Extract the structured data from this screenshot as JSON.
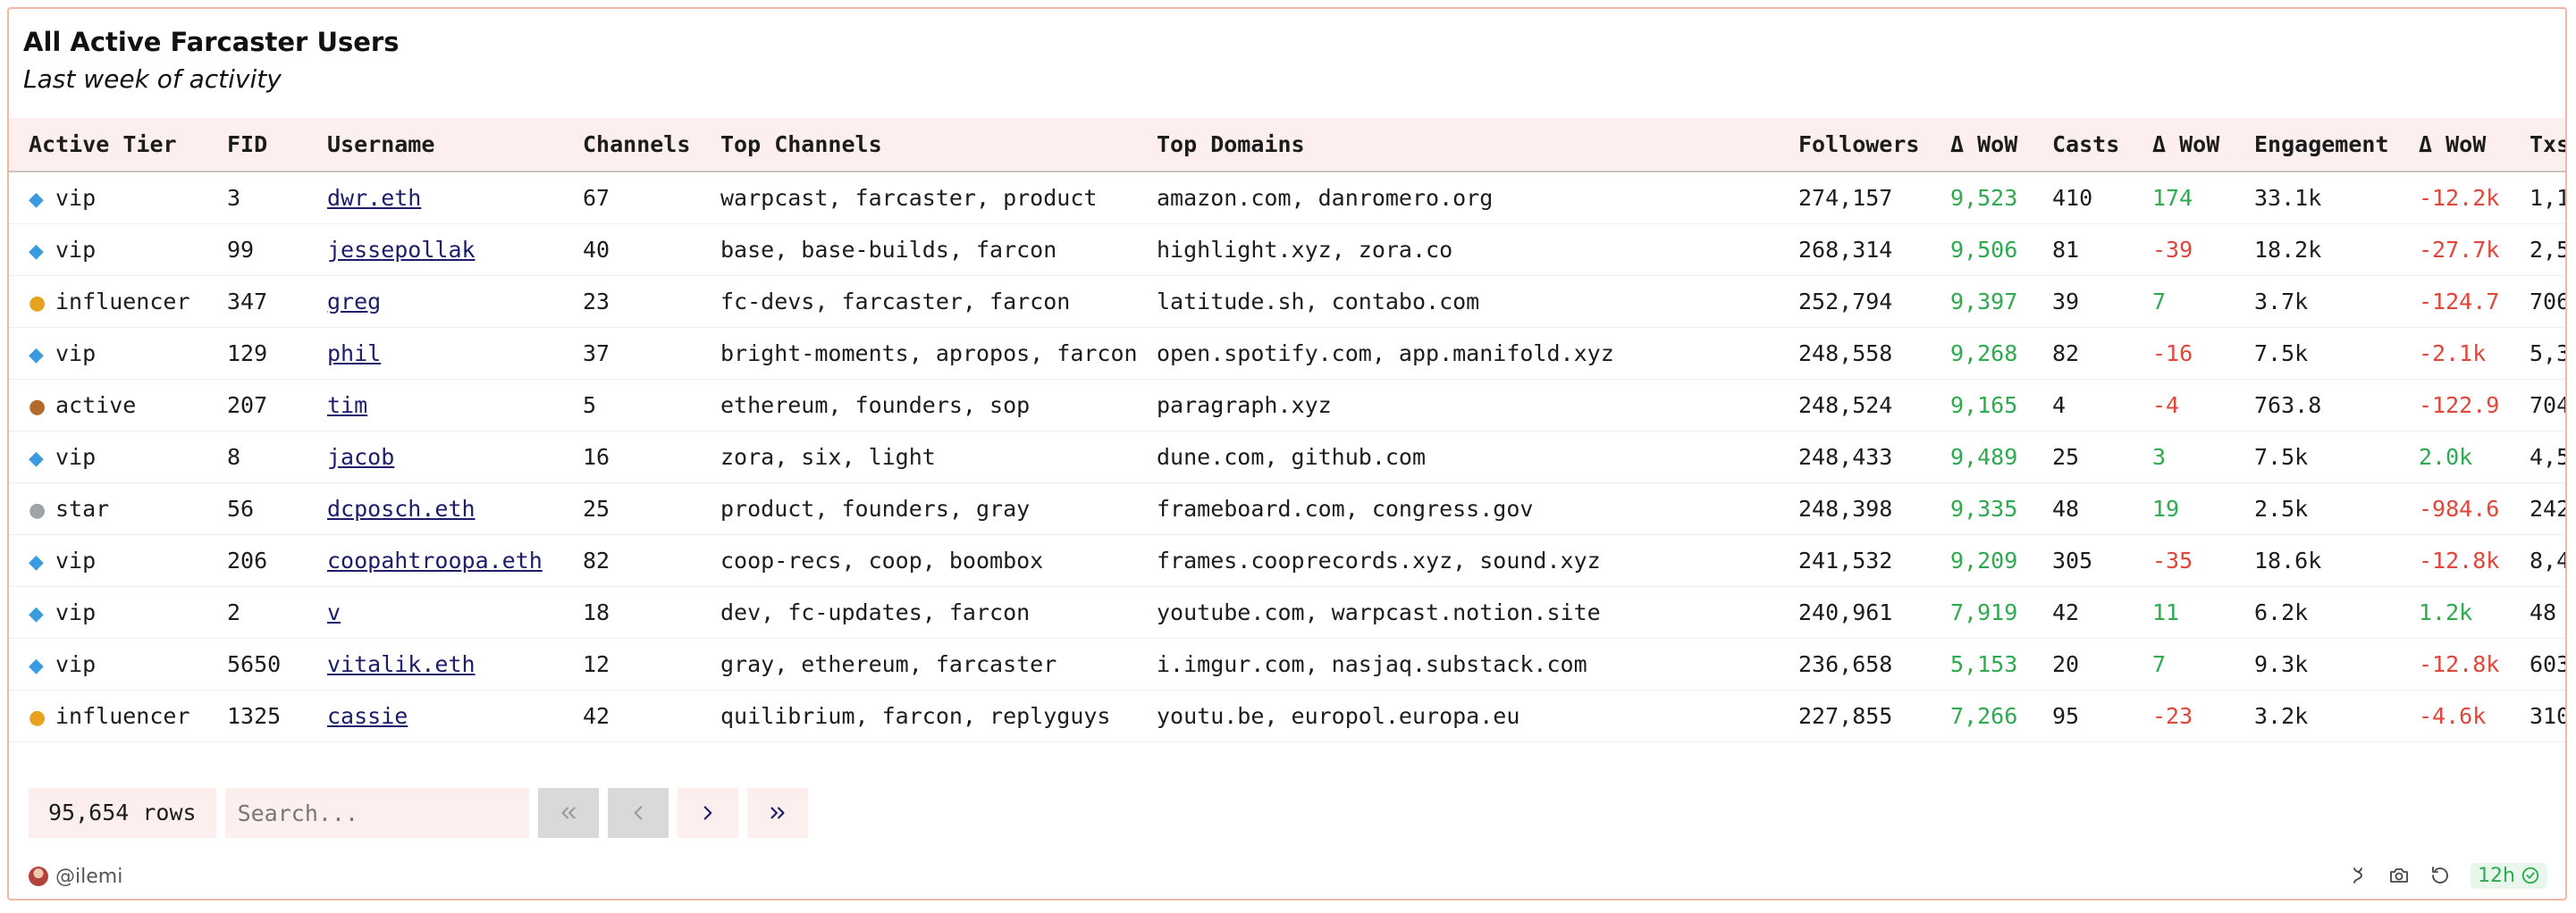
{
  "header": {
    "title": "All Active Farcaster Users",
    "subtitle": "Last week of activity"
  },
  "table": {
    "columns": [
      "Active Tier",
      "FID",
      "Username",
      "Channels",
      "Top Channels",
      "Top Domains",
      "Followers",
      "Δ WoW",
      "Casts",
      "Δ WoW",
      "Engagement",
      "Δ WoW",
      "Txs"
    ],
    "rows": [
      {
        "icon": "diamond-icon",
        "tier": "vip",
        "fid": "3",
        "username": "dwr.eth",
        "channels": "67",
        "top_channels": "warpcast, farcaster, product",
        "top_domains": "amazon.com, danromero.org",
        "followers": "274,157",
        "followers_wow": "9,523",
        "followers_wow_sign": "pos",
        "casts": "410",
        "casts_wow": "174",
        "casts_wow_sign": "pos",
        "engagement": "33.1k",
        "engagement_wow": "-12.2k",
        "engagement_wow_sign": "neg",
        "txs": "1,1"
      },
      {
        "icon": "diamond-icon",
        "tier": "vip",
        "fid": "99",
        "username": "jessepollak",
        "channels": "40",
        "top_channels": "base, base-builds, farcon",
        "top_domains": "highlight.xyz, zora.co",
        "followers": "268,314",
        "followers_wow": "9,506",
        "followers_wow_sign": "pos",
        "casts": "81",
        "casts_wow": "-39",
        "casts_wow_sign": "neg",
        "engagement": "18.2k",
        "engagement_wow": "-27.7k",
        "engagement_wow_sign": "neg",
        "txs": "2,5"
      },
      {
        "icon": "gold-medal-icon",
        "tier": "influencer",
        "fid": "347",
        "username": "greg",
        "channels": "23",
        "top_channels": "fc-devs, farcaster, farcon",
        "top_domains": "latitude.sh, contabo.com",
        "followers": "252,794",
        "followers_wow": "9,397",
        "followers_wow_sign": "pos",
        "casts": "39",
        "casts_wow": "7",
        "casts_wow_sign": "pos",
        "engagement": "3.7k",
        "engagement_wow": "-124.7",
        "engagement_wow_sign": "neg",
        "txs": "706"
      },
      {
        "icon": "diamond-icon",
        "tier": "vip",
        "fid": "129",
        "username": "phil",
        "channels": "37",
        "top_channels": "bright-moments, apropos, farcon",
        "top_domains": "open.spotify.com, app.manifold.xyz",
        "followers": "248,558",
        "followers_wow": "9,268",
        "followers_wow_sign": "pos",
        "casts": "82",
        "casts_wow": "-16",
        "casts_wow_sign": "neg",
        "engagement": "7.5k",
        "engagement_wow": "-2.1k",
        "engagement_wow_sign": "neg",
        "txs": "5,3"
      },
      {
        "icon": "bronze-medal-icon",
        "tier": "active",
        "fid": "207",
        "username": "tim",
        "channels": "5",
        "top_channels": "ethereum, founders, sop",
        "top_domains": "paragraph.xyz",
        "followers": "248,524",
        "followers_wow": "9,165",
        "followers_wow_sign": "pos",
        "casts": "4",
        "casts_wow": "-4",
        "casts_wow_sign": "neg",
        "engagement": "763.8",
        "engagement_wow": "-122.9",
        "engagement_wow_sign": "neg",
        "txs": "704"
      },
      {
        "icon": "diamond-icon",
        "tier": "vip",
        "fid": "8",
        "username": "jacob",
        "channels": "16",
        "top_channels": "zora, six, light",
        "top_domains": "dune.com, github.com",
        "followers": "248,433",
        "followers_wow": "9,489",
        "followers_wow_sign": "pos",
        "casts": "25",
        "casts_wow": "3",
        "casts_wow_sign": "pos",
        "engagement": "7.5k",
        "engagement_wow": "2.0k",
        "engagement_wow_sign": "pos",
        "txs": "4,5"
      },
      {
        "icon": "silver-medal-icon",
        "tier": "star",
        "fid": "56",
        "username": "dcposch.eth",
        "channels": "25",
        "top_channels": "product, founders, gray",
        "top_domains": "frameboard.com, congress.gov",
        "followers": "248,398",
        "followers_wow": "9,335",
        "followers_wow_sign": "pos",
        "casts": "48",
        "casts_wow": "19",
        "casts_wow_sign": "pos",
        "engagement": "2.5k",
        "engagement_wow": "-984.6",
        "engagement_wow_sign": "neg",
        "txs": "242"
      },
      {
        "icon": "diamond-icon",
        "tier": "vip",
        "fid": "206",
        "username": "coopahtroopa.eth",
        "channels": "82",
        "top_channels": "coop-recs, coop, boombox",
        "top_domains": "frames.cooprecords.xyz, sound.xyz",
        "followers": "241,532",
        "followers_wow": "9,209",
        "followers_wow_sign": "pos",
        "casts": "305",
        "casts_wow": "-35",
        "casts_wow_sign": "neg",
        "engagement": "18.6k",
        "engagement_wow": "-12.8k",
        "engagement_wow_sign": "neg",
        "txs": "8,4"
      },
      {
        "icon": "diamond-icon",
        "tier": "vip",
        "fid": "2",
        "username": "v",
        "channels": "18",
        "top_channels": "dev, fc-updates, farcon",
        "top_domains": "youtube.com, warpcast.notion.site",
        "followers": "240,961",
        "followers_wow": "7,919",
        "followers_wow_sign": "pos",
        "casts": "42",
        "casts_wow": "11",
        "casts_wow_sign": "pos",
        "engagement": "6.2k",
        "engagement_wow": "1.2k",
        "engagement_wow_sign": "pos",
        "txs": "48"
      },
      {
        "icon": "diamond-icon",
        "tier": "vip",
        "fid": "5650",
        "username": "vitalik.eth",
        "channels": "12",
        "top_channels": "gray, ethereum, farcaster",
        "top_domains": "i.imgur.com, nasjaq.substack.com",
        "followers": "236,658",
        "followers_wow": "5,153",
        "followers_wow_sign": "pos",
        "casts": "20",
        "casts_wow": "7",
        "casts_wow_sign": "pos",
        "engagement": "9.3k",
        "engagement_wow": "-12.8k",
        "engagement_wow_sign": "neg",
        "txs": "603"
      },
      {
        "icon": "gold-medal-icon",
        "tier": "influencer",
        "fid": "1325",
        "username": "cassie",
        "channels": "42",
        "top_channels": "quilibrium, farcon, replyguys",
        "top_domains": "youtu.be, europol.europa.eu",
        "followers": "227,855",
        "followers_wow": "7,266",
        "followers_wow_sign": "pos",
        "casts": "95",
        "casts_wow": "-23",
        "casts_wow_sign": "neg",
        "engagement": "3.2k",
        "engagement_wow": "-4.6k",
        "engagement_wow_sign": "neg",
        "txs": "310"
      }
    ]
  },
  "pagination": {
    "rows_label": "95,654 rows",
    "search_placeholder": "Search..."
  },
  "footer": {
    "author": "@ilemi",
    "refresh_label": "12h"
  },
  "colors": {
    "accent_border": "#f2b8a2",
    "header_bg": "#fcefed",
    "positive": "#2eaa4f",
    "negative": "#e0463a",
    "link": "#1d1d6b"
  }
}
